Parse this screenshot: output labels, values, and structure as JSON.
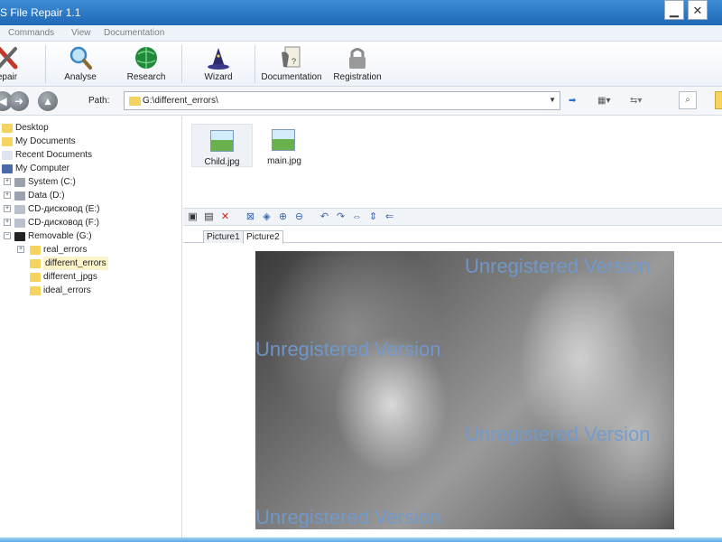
{
  "window": {
    "title": "S File Repair 1.1",
    "minimize_label": "▁",
    "close_label": "✕"
  },
  "menu": {
    "items": [
      "Commands",
      "View",
      "Documentation"
    ]
  },
  "toolbar": {
    "buttons": [
      {
        "label": "epair",
        "icon": "repair-tools-icon"
      },
      {
        "label": "Analyse",
        "icon": "magnifier-icon"
      },
      {
        "label": "Research",
        "icon": "globe-icon"
      },
      {
        "label": "Wizard",
        "icon": "wizard-hat-icon"
      },
      {
        "label": "Documentation",
        "icon": "documentation-icon"
      },
      {
        "label": "Registration",
        "icon": "lock-icon"
      }
    ]
  },
  "pathbar": {
    "label": "Path:",
    "value": "G:\\different_errors\\"
  },
  "tree": {
    "items": [
      {
        "label": "Desktop"
      },
      {
        "label": "My Documents"
      },
      {
        "label": "Recent Documents"
      },
      {
        "label": "My Computer"
      },
      {
        "label": "System (C:)"
      },
      {
        "label": "Data (D:)"
      },
      {
        "label": "CD-дисковод (E:)"
      },
      {
        "label": "CD-дисковод (F:)"
      },
      {
        "label": "Removable (G:)"
      },
      {
        "label": "real_errors"
      },
      {
        "label": "different_errors"
      },
      {
        "label": "different_jpgs"
      },
      {
        "label": "ideal_errors"
      }
    ]
  },
  "files": [
    {
      "name": "Child.jpg"
    },
    {
      "name": "main.jpg"
    }
  ],
  "tabs": [
    {
      "label": "Picture1"
    },
    {
      "label": "Picture2"
    }
  ],
  "viewer": {
    "watermark": "Unregistered Version"
  },
  "colors": {
    "titlebar": "#2a78c8",
    "watermark": "#6f9bd2",
    "selection": "#fdf3c8"
  }
}
